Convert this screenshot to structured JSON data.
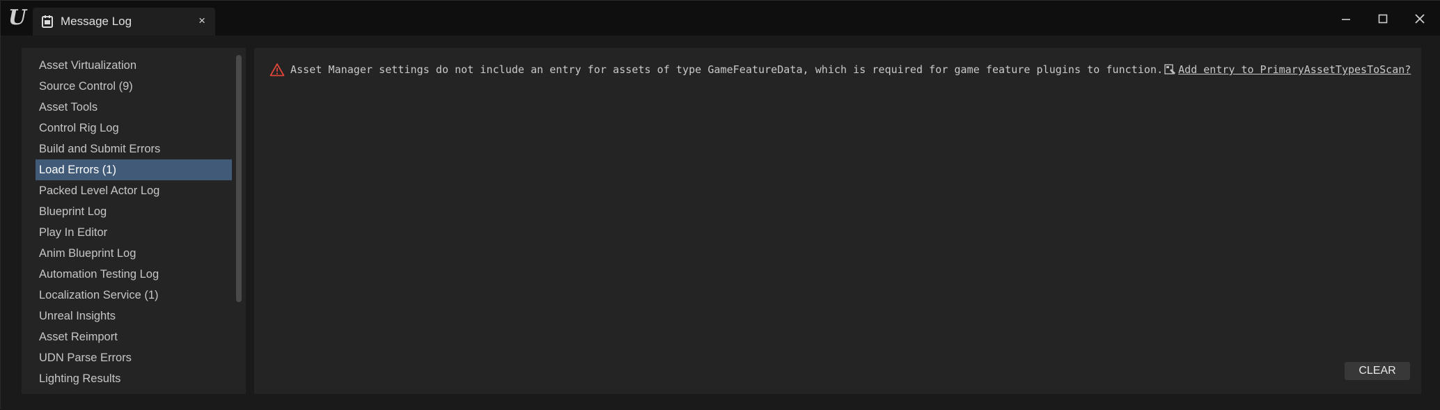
{
  "window": {
    "tab_title": "Message Log",
    "tab_close_glyph": "×",
    "logo_glyph": "U",
    "controls": [
      "minimize-icon",
      "maximize-icon",
      "close-icon"
    ]
  },
  "categories": [
    {
      "label": "Asset Virtualization",
      "selected": false
    },
    {
      "label": "Source Control (9)",
      "selected": false
    },
    {
      "label": "Asset Tools",
      "selected": false
    },
    {
      "label": "Control Rig Log",
      "selected": false
    },
    {
      "label": "Build and Submit Errors",
      "selected": false
    },
    {
      "label": "Load Errors (1)",
      "selected": true
    },
    {
      "label": "Packed Level Actor Log",
      "selected": false
    },
    {
      "label": "Blueprint Log",
      "selected": false
    },
    {
      "label": "Play In Editor",
      "selected": false
    },
    {
      "label": "Anim Blueprint Log",
      "selected": false
    },
    {
      "label": "Automation Testing Log",
      "selected": false
    },
    {
      "label": "Localization Service (1)",
      "selected": false
    },
    {
      "label": "Unreal Insights",
      "selected": false
    },
    {
      "label": "Asset Reimport",
      "selected": false
    },
    {
      "label": "UDN Parse Errors",
      "selected": false
    },
    {
      "label": "Lighting Results",
      "selected": false
    }
  ],
  "messages": [
    {
      "severity": "warning",
      "icon": "warning-icon",
      "text": "Asset Manager settings do not include an entry for assets of type GameFeatureData, which is required for game feature plugins to function.",
      "fix_icon": "fix-action-icon",
      "link": "Add entry to PrimaryAssetTypesToScan?"
    }
  ],
  "actions": {
    "clear_label": "CLEAR"
  },
  "colors": {
    "selected_bg": "#405a78",
    "warning": "#e0453a",
    "panel_bg": "#242424",
    "text": "#c6c6c6"
  }
}
